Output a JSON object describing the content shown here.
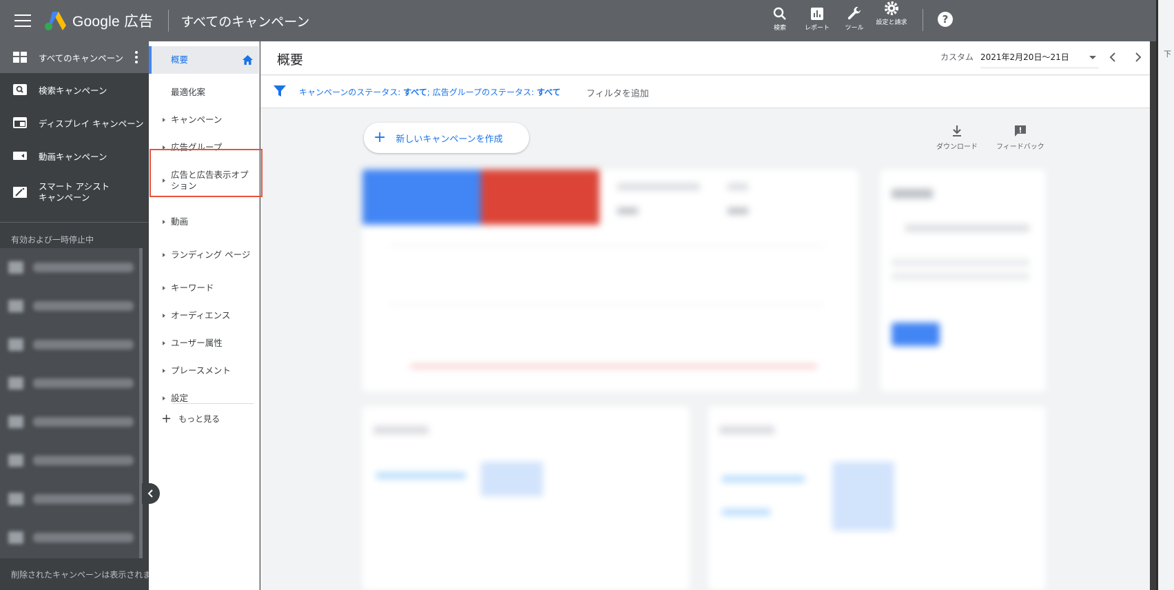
{
  "topbar": {
    "brand": "Google 広告",
    "page_heading": "すべてのキャンペーン",
    "actions": [
      {
        "label": "検索",
        "icon": "search-icon"
      },
      {
        "label": "レポート",
        "icon": "report-icon"
      },
      {
        "label": "ツール",
        "icon": "wrench-icon"
      },
      {
        "label": "設定と請求",
        "icon": "gear-icon"
      }
    ],
    "help": "?"
  },
  "sidebar": {
    "items": [
      {
        "label": "すべてのキャンペーン",
        "icon": "dashboard-icon"
      },
      {
        "label": "検索キャンペーン",
        "icon": "search-campaign-icon"
      },
      {
        "label": "ディスプレイ キャンペーン",
        "icon": "display-icon"
      },
      {
        "label": "動画キャンペーン",
        "icon": "video-icon"
      },
      {
        "label": "スマート アシスト キャンペーン",
        "icon": "smart-assist-icon"
      }
    ],
    "section_label": "有効および一時停止中",
    "footer": "削除されたキャンペーンは表示されま"
  },
  "nav": {
    "overview": "概要",
    "items": [
      "最適化案",
      "キャンペーン",
      "広告グループ",
      "広告と広告表示オプション",
      "動画",
      "ランディング ページ",
      "キーワード",
      "オーディエンス",
      "ユーザー属性",
      "プレースメント",
      "設定"
    ],
    "more": "もっと見る"
  },
  "main": {
    "title": "概要",
    "date_label": "カスタム",
    "date_value": "2021年2月20日～21日",
    "filter": {
      "campaign_status_label": "キャンペーンのステータス: ",
      "campaign_status_value": "すべて",
      "sep": "; ",
      "adgroup_status_label": "広告グループのステータス: ",
      "adgroup_status_value": "すべて",
      "add": "フィルタを追加"
    },
    "new_campaign": "新しいキャンペーンを作成",
    "download": "ダウンロード",
    "feedback": "フィードバック"
  },
  "colors": {
    "accent": "#1a73e8",
    "topbar": "#5f6368",
    "sidebar": "#3c4043",
    "highlight": "#e8513a",
    "card_blue": "#4285f4",
    "card_red": "#db4437"
  },
  "right_edge": {
    "text": "下"
  }
}
